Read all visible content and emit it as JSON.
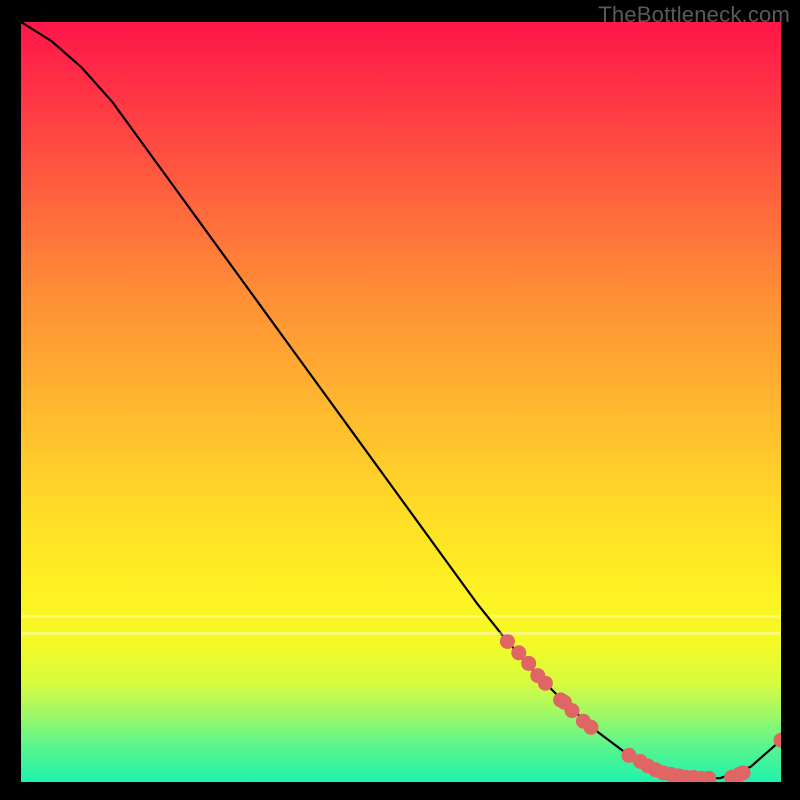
{
  "watermark": "TheBottleneck.com",
  "chart_data": {
    "type": "line",
    "title": "",
    "xlabel": "",
    "ylabel": "",
    "xlim": [
      0,
      1
    ],
    "ylim": [
      0,
      1
    ],
    "grid": false,
    "legend": false,
    "series": [
      {
        "name": "bottleneck-curve",
        "name_display": "",
        "color": "#000000",
        "x": [
          0.0,
          0.04,
          0.08,
          0.12,
          0.16,
          0.2,
          0.24,
          0.28,
          0.32,
          0.36,
          0.4,
          0.44,
          0.48,
          0.52,
          0.56,
          0.6,
          0.64,
          0.68,
          0.72,
          0.76,
          0.8,
          0.84,
          0.88,
          0.92,
          0.96,
          1.0
        ],
        "y": [
          1.0,
          0.975,
          0.94,
          0.895,
          0.84,
          0.785,
          0.73,
          0.675,
          0.62,
          0.565,
          0.51,
          0.455,
          0.4,
          0.345,
          0.29,
          0.235,
          0.185,
          0.14,
          0.1,
          0.065,
          0.035,
          0.015,
          0.005,
          0.005,
          0.02,
          0.055
        ]
      },
      {
        "name": "lower-cluster-points",
        "name_display": "",
        "type": "scatter",
        "color": "#e06666",
        "x": [
          0.64,
          0.655,
          0.668,
          0.68,
          0.69,
          0.71,
          0.715,
          0.725,
          0.74,
          0.75,
          0.8,
          0.815,
          0.825,
          0.835,
          0.845,
          0.855,
          0.865,
          0.875,
          0.885,
          0.895,
          0.905,
          0.935,
          0.945,
          0.95,
          1.0
        ],
        "y": [
          0.185,
          0.17,
          0.156,
          0.14,
          0.13,
          0.108,
          0.105,
          0.094,
          0.08,
          0.072,
          0.035,
          0.027,
          0.021,
          0.016,
          0.012,
          0.01,
          0.008,
          0.006,
          0.006,
          0.005,
          0.005,
          0.006,
          0.01,
          0.012,
          0.055
        ]
      }
    ],
    "background_gradient": {
      "direction": "vertical",
      "stops": [
        {
          "pos": 0.0,
          "color": "#ff154a"
        },
        {
          "pos": 0.36,
          "color": "#ff8f36"
        },
        {
          "pos": 0.66,
          "color": "#ffe026"
        },
        {
          "pos": 0.87,
          "color": "#d6fb3f"
        },
        {
          "pos": 1.0,
          "color": "#1ef3ad"
        }
      ]
    }
  }
}
